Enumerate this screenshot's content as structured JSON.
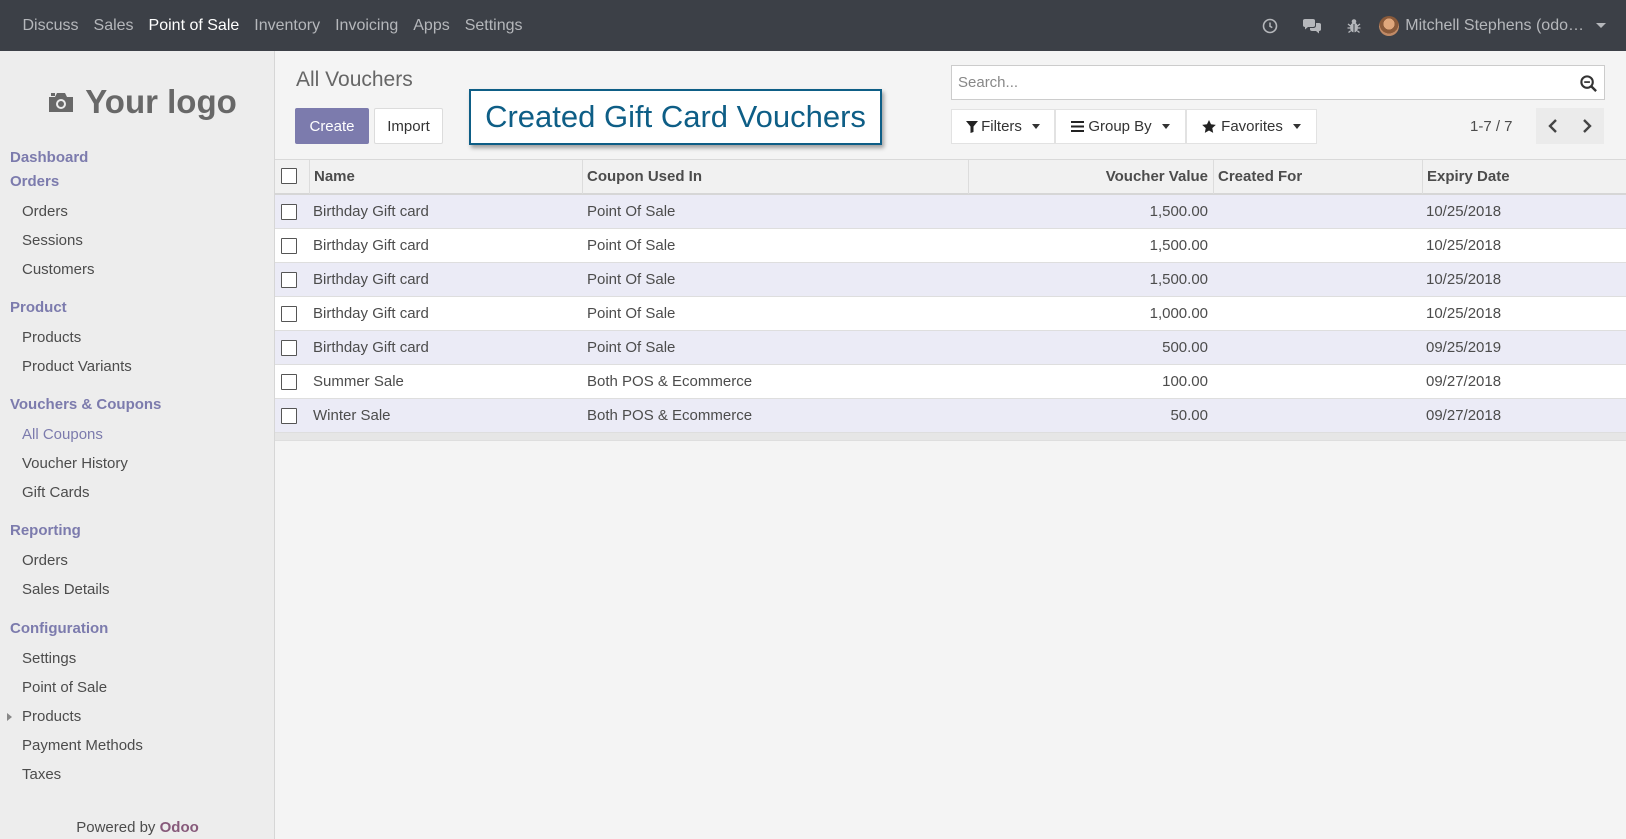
{
  "topbar": {
    "nav": [
      "Discuss",
      "Sales",
      "Point of Sale",
      "Inventory",
      "Invoicing",
      "Apps",
      "Settings"
    ],
    "active": "Point of Sale",
    "user": "Mitchell Stephens (odo…",
    "icons": [
      "clock-icon",
      "chat-icon",
      "bug-icon"
    ]
  },
  "sidebar": {
    "logo_text": "Your logo",
    "sections": [
      {
        "title": "Dashboard",
        "items": []
      },
      {
        "title": "Orders",
        "items": [
          "Orders",
          "Sessions",
          "Customers"
        ]
      },
      {
        "title": "Product",
        "items": [
          "Products",
          "Product Variants"
        ]
      },
      {
        "title": "Vouchers & Coupons",
        "items": [
          "All Coupons",
          "Voucher History",
          "Gift Cards"
        ]
      },
      {
        "title": "Reporting",
        "items": [
          "Orders",
          "Sales Details"
        ]
      },
      {
        "title": "Configuration",
        "items": [
          "Settings",
          "Point of Sale",
          "Products",
          "Payment Methods",
          "Taxes"
        ]
      }
    ],
    "selected_item": "All Coupons",
    "powered_prefix": "Powered by ",
    "powered_brand": "Odoo"
  },
  "control": {
    "title": "All Vouchers",
    "create_label": "Create",
    "import_label": "Import",
    "annotation": "Created Gift Card Vouchers",
    "search_placeholder": "Search...",
    "filters_label": "Filters",
    "groupby_label": "Group By",
    "favorites_label": "Favorites",
    "pager": "1-7 / 7"
  },
  "table": {
    "columns": [
      "Name",
      "Coupon Used In",
      "Voucher Value",
      "Created For",
      "Expiry Date"
    ],
    "rows": [
      {
        "name": "Birthday Gift card",
        "used_in": "Point Of Sale",
        "value": "1,500.00",
        "created_for": "",
        "expiry": "10/25/2018"
      },
      {
        "name": "Birthday Gift card",
        "used_in": "Point Of Sale",
        "value": "1,500.00",
        "created_for": "",
        "expiry": "10/25/2018"
      },
      {
        "name": "Birthday Gift card",
        "used_in": "Point Of Sale",
        "value": "1,500.00",
        "created_for": "",
        "expiry": "10/25/2018"
      },
      {
        "name": "Birthday Gift card",
        "used_in": "Point Of Sale",
        "value": "1,000.00",
        "created_for": "",
        "expiry": "10/25/2018"
      },
      {
        "name": "Birthday Gift card",
        "used_in": "Point Of Sale",
        "value": "500.00",
        "created_for": "",
        "expiry": "09/25/2019"
      },
      {
        "name": "Summer Sale",
        "used_in": "Both POS & Ecommerce",
        "value": "100.00",
        "created_for": "",
        "expiry": "09/27/2018"
      },
      {
        "name": "Winter Sale",
        "used_in": "Both POS & Ecommerce",
        "value": "50.00",
        "created_for": "",
        "expiry": "09/27/2018"
      }
    ]
  },
  "colors": {
    "accent": "#7c7bad",
    "topbar": "#3c4047",
    "annotation": "#0e5e86",
    "brand": "#875a7b"
  }
}
